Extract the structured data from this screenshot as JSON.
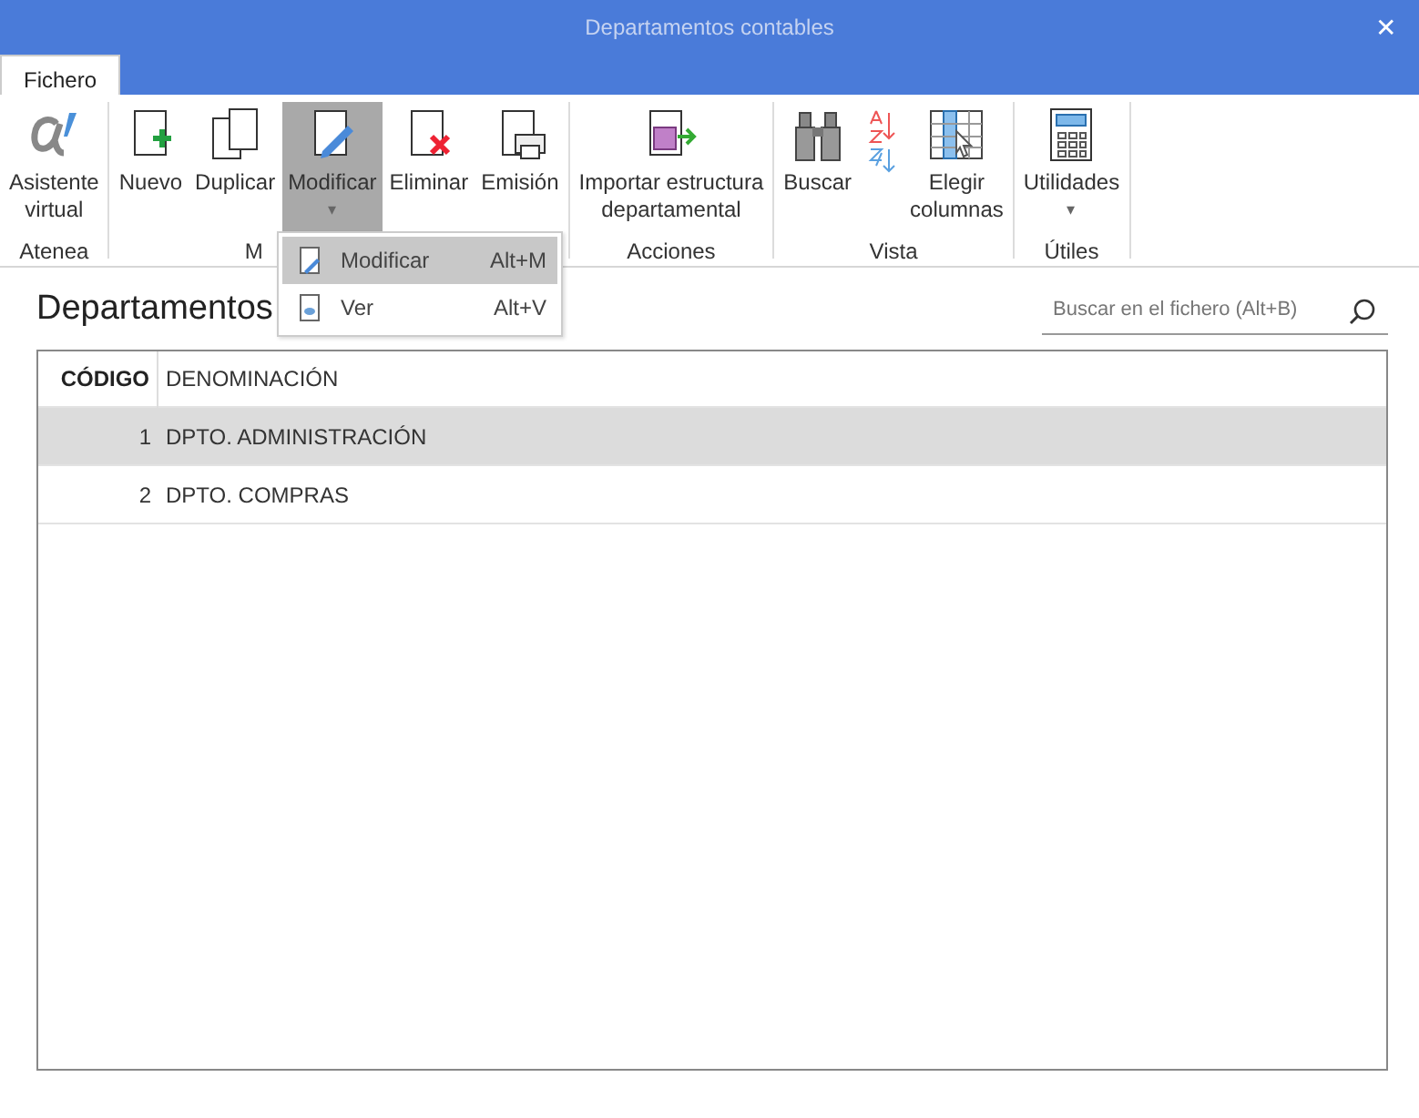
{
  "window": {
    "title": "Departamentos contables",
    "close": "✕"
  },
  "tabs": [
    {
      "label": "Fichero",
      "selected": true
    }
  ],
  "ribbon": {
    "groups": [
      {
        "label": "Atenea",
        "buttons": [
          {
            "kind": "alpha",
            "lines": [
              "Asistente",
              "virtual"
            ],
            "pressed": false
          }
        ]
      },
      {
        "label": "M",
        "buttons": [
          {
            "kind": "new",
            "lines": [
              "Nuevo"
            ],
            "pressed": false
          },
          {
            "kind": "copy",
            "lines": [
              "Duplicar"
            ],
            "pressed": false
          },
          {
            "kind": "edit",
            "lines": [
              "Modificar"
            ],
            "pressed": true,
            "caret": "▾"
          },
          {
            "kind": "delete",
            "lines": [
              "Eliminar"
            ],
            "pressed": false
          },
          {
            "kind": "print",
            "lines": [
              "Emisión"
            ],
            "pressed": false
          }
        ]
      },
      {
        "label": "Acciones",
        "buttons": [
          {
            "kind": "import",
            "lines": [
              "Importar estructura",
              "departamental"
            ],
            "pressed": false
          }
        ]
      },
      {
        "label": "Vista",
        "buttons": [
          {
            "kind": "binoculars",
            "lines": [
              "Buscar"
            ],
            "pressed": false
          },
          {
            "kind": "sort",
            "pressed": false
          },
          {
            "kind": "columns",
            "lines": [
              "Elegir",
              "columnas"
            ],
            "pressed": false
          }
        ]
      },
      {
        "label": "Útiles",
        "buttons": [
          {
            "kind": "calc",
            "lines": [
              "Utilidades"
            ],
            "pressed": false,
            "caret": "▾"
          }
        ]
      }
    ]
  },
  "menu": {
    "items": [
      {
        "kind": "edit",
        "label": "Modificar",
        "shortcut": "Alt+M",
        "selected": true
      },
      {
        "kind": "view",
        "label": "Ver",
        "shortcut": "Alt+V",
        "selected": false
      }
    ]
  },
  "heading": "Departamentos",
  "search": {
    "placeholder": "Buscar en el fichero (Alt+B)"
  },
  "table": {
    "columns": [
      "CÓDIGO",
      "DENOMINACIÓN"
    ],
    "rows": [
      {
        "cells": [
          "1",
          "DPTO. ADMINISTRACIÓN"
        ],
        "selected": true
      },
      {
        "cells": [
          "2",
          "DPTO. COMPRAS"
        ],
        "selected": false
      }
    ]
  }
}
